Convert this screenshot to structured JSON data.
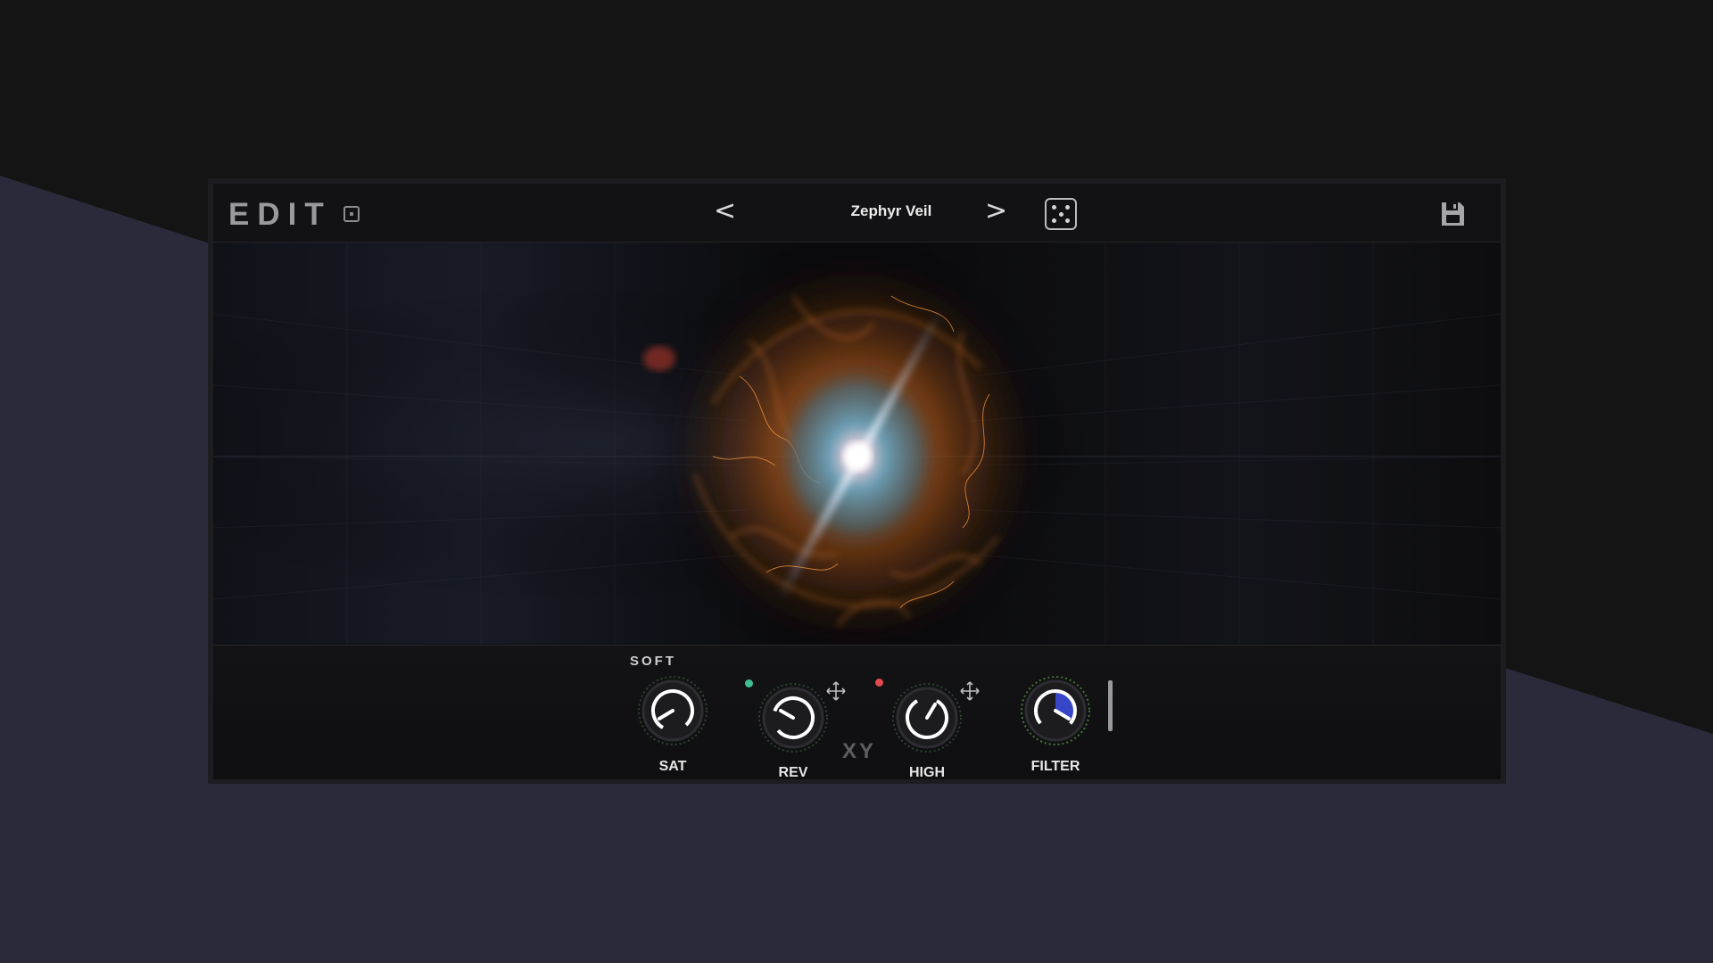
{
  "header": {
    "title": "EDIT",
    "preset_name": "Zephyr Veil",
    "prev_label": "<",
    "next_label": ">"
  },
  "controls": {
    "mode_label": "SOFT",
    "knobs": [
      {
        "id": "sat",
        "label": "SAT"
      },
      {
        "id": "rev",
        "label": "REV"
      },
      {
        "id": "high",
        "label": "HIGH"
      },
      {
        "id": "filter",
        "label": "FILTER"
      }
    ],
    "xy_label": "XY"
  },
  "colors": {
    "rev_dot": "#3fbf8f",
    "high_dot": "#e04b4b",
    "accent_filter": "#3a4bd8"
  },
  "icons": [
    "edit-toggle-icon",
    "dice-icon",
    "save-icon",
    "move-icon"
  ]
}
